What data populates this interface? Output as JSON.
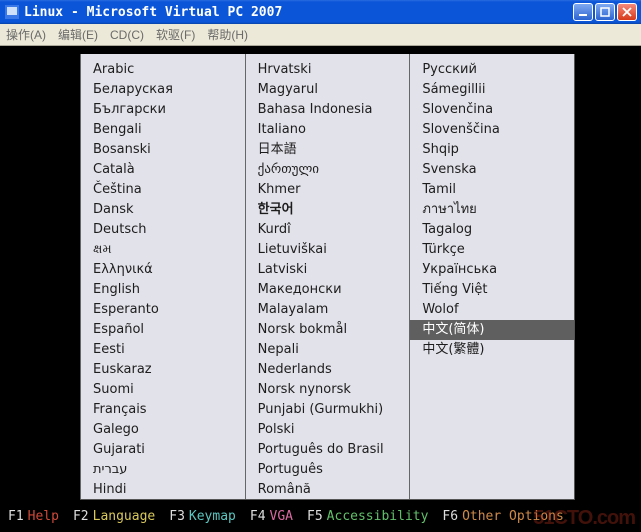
{
  "window": {
    "title": "Linux - Microsoft Virtual PC 2007"
  },
  "menubar": {
    "items": [
      "操作(A)",
      "编辑(E)",
      "CD(C)",
      "软驱(F)",
      "帮助(H)"
    ]
  },
  "language_columns": [
    [
      "Arabic",
      "Беларуская",
      "Български",
      "Bengali",
      "Bosanski",
      "Català",
      "Čeština",
      "Dansk",
      "Deutsch",
      "ક્ષમ",
      "Ελληνικά",
      "English",
      "Esperanto",
      "Español",
      "Eesti",
      "Euskaraz",
      "Suomi",
      "Français",
      "Galego",
      "Gujarati",
      "עברית",
      "Hindi"
    ],
    [
      "Hrvatski",
      "Magyarul",
      "Bahasa Indonesia",
      "Italiano",
      "日本語",
      "ქართული",
      "Khmer",
      "한국어",
      "Kurdî",
      "Lietuviškai",
      "Latviski",
      "Македонски",
      "Malayalam",
      "Norsk bokmål",
      "Nepali",
      "Nederlands",
      "Norsk nynorsk",
      "Punjabi (Gurmukhi)",
      "Polski",
      "Português do Brasil",
      "Português",
      "Română"
    ],
    [
      "Русский",
      "Sámegillii",
      "Slovenčina",
      "Slovenščina",
      "Shqip",
      "Svenska",
      "Tamil",
      "ภาษาไทย",
      "Tagalog",
      "Türkçe",
      "Українська",
      "Tiếng Việt",
      "Wolof",
      "中文(简体)",
      "中文(繁體)"
    ]
  ],
  "bold_items": [
    "한국어"
  ],
  "selected_item": "中文(简体)",
  "fkeys": [
    {
      "key": "F1",
      "label": "Help",
      "cls": "c-red"
    },
    {
      "key": "F2",
      "label": "Language",
      "cls": "c-yellow"
    },
    {
      "key": "F3",
      "label": "Keymap",
      "cls": "c-cyan"
    },
    {
      "key": "F4",
      "label": "VGA",
      "cls": "c-pink"
    },
    {
      "key": "F5",
      "label": "Accessibility",
      "cls": "c-green"
    },
    {
      "key": "F6",
      "label": "Other Options",
      "cls": "c-orange"
    }
  ],
  "watermark": "51CTO.com"
}
